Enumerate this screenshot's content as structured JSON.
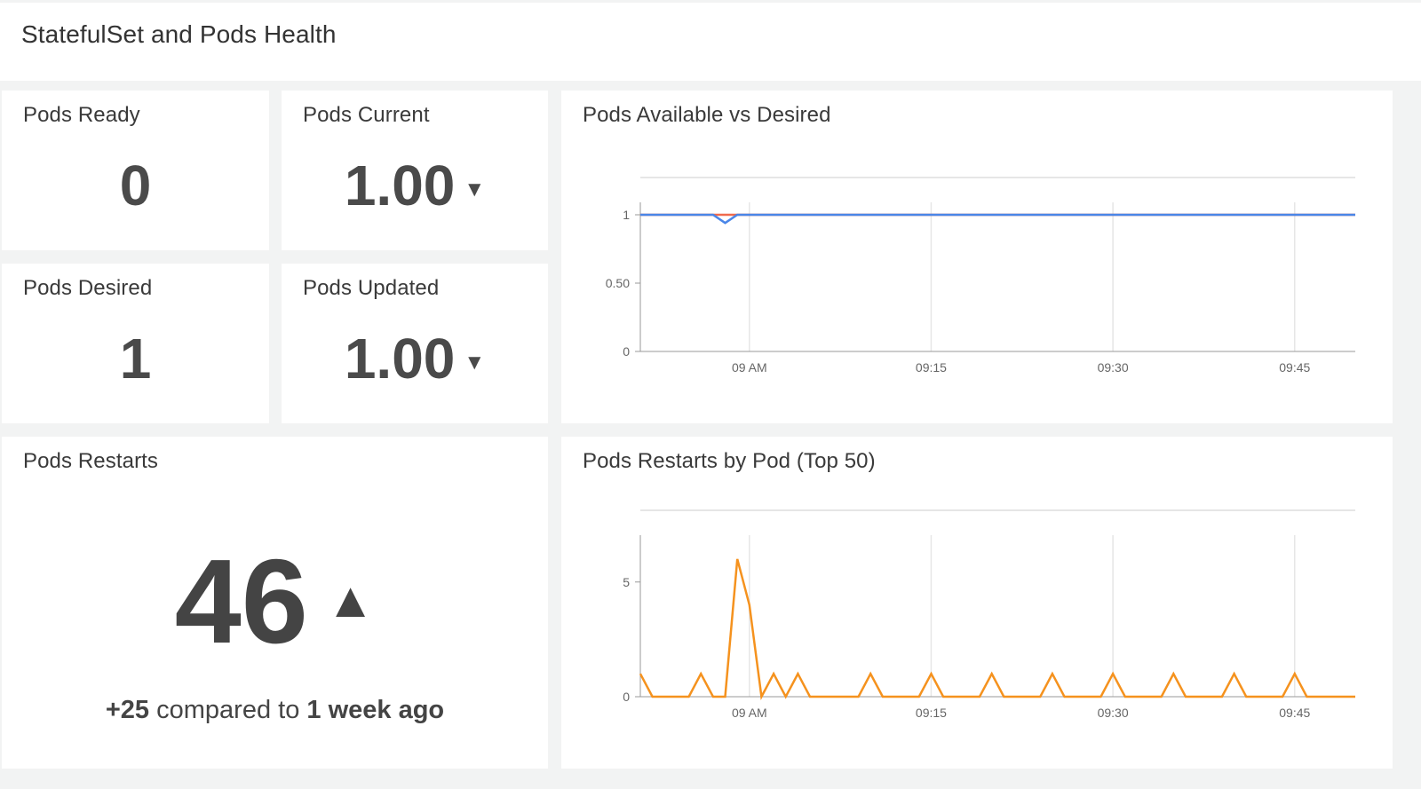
{
  "header": {
    "title": "StatefulSet and Pods Health"
  },
  "stats": {
    "pods_ready": {
      "title": "Pods Ready",
      "value": "0"
    },
    "pods_current": {
      "title": "Pods Current",
      "value": "1.00",
      "trend_icon": "arrow-down-icon",
      "trend_glyph": "▼"
    },
    "pods_desired": {
      "title": "Pods Desired",
      "value": "1"
    },
    "pods_updated": {
      "title": "Pods Updated",
      "value": "1.00",
      "trend_icon": "arrow-down-icon",
      "trend_glyph": "▼"
    }
  },
  "restarts": {
    "title": "Pods Restarts",
    "value": "46",
    "trend_icon": "arrow-up-icon",
    "trend_glyph": "▲",
    "delta": "+25",
    "compare_text": "compared to",
    "period": "1 week ago"
  },
  "charts": {
    "available_vs_desired": {
      "title": "Pods Available vs Desired"
    },
    "restarts_by_pod": {
      "title": "Pods Restarts by Pod (Top 50)"
    }
  },
  "colors": {
    "available": "#4a86e8",
    "desired": "#f06a4d",
    "restarts": "#f5921e",
    "grid": "#e6e6e6"
  },
  "chart_data": [
    {
      "type": "line",
      "title": "Pods Available vs Desired",
      "xlabel": "",
      "ylabel": "",
      "ylim": [
        0,
        1
      ],
      "y_ticks": [
        "0",
        "0.50",
        "1"
      ],
      "x_ticks": [
        "09 AM",
        "09:15",
        "09:30",
        "09:45"
      ],
      "x_tick_minutes": [
        0,
        15,
        30,
        45
      ],
      "xlim": [
        -9,
        50
      ],
      "grid": true,
      "series": [
        {
          "x": [
            -9,
            -4,
            -2,
            -1,
            50
          ],
          "values": [
            1,
            1,
            1,
            1,
            1
          ]
        },
        {
          "x": [
            -9,
            -3,
            -2,
            -1,
            50
          ],
          "values": [
            1,
            1,
            0.94,
            1,
            1
          ]
        }
      ]
    },
    {
      "type": "line",
      "title": "Pods Restarts by Pod (Top 50)",
      "xlabel": "",
      "ylabel": "",
      "ylim": [
        0,
        6.5
      ],
      "y_ticks": [
        "0",
        "5"
      ],
      "y_tick_values": [
        0,
        5
      ],
      "x_ticks": [
        "09 AM",
        "09:15",
        "09:30",
        "09:45"
      ],
      "x_tick_minutes": [
        0,
        15,
        30,
        45
      ],
      "xlim": [
        -9,
        50
      ],
      "grid": true,
      "series": [
        {
          "x": [
            -9,
            -8,
            -5,
            -4,
            -3,
            -2,
            -1,
            0,
            1,
            2,
            3,
            4,
            5,
            6,
            9,
            10,
            11,
            14,
            15,
            16,
            19,
            20,
            21,
            24,
            25,
            26,
            29,
            30,
            31,
            34,
            35,
            36,
            39,
            40,
            41,
            44,
            45,
            46,
            50
          ],
          "values": [
            1,
            0,
            0,
            1,
            0,
            0,
            6,
            4,
            0,
            1,
            0,
            1,
            0,
            0,
            0,
            1,
            0,
            0,
            1,
            0,
            0,
            1,
            0,
            0,
            1,
            0,
            0,
            1,
            0,
            0,
            1,
            0,
            0,
            1,
            0,
            0,
            1,
            0,
            0
          ]
        }
      ]
    }
  ]
}
